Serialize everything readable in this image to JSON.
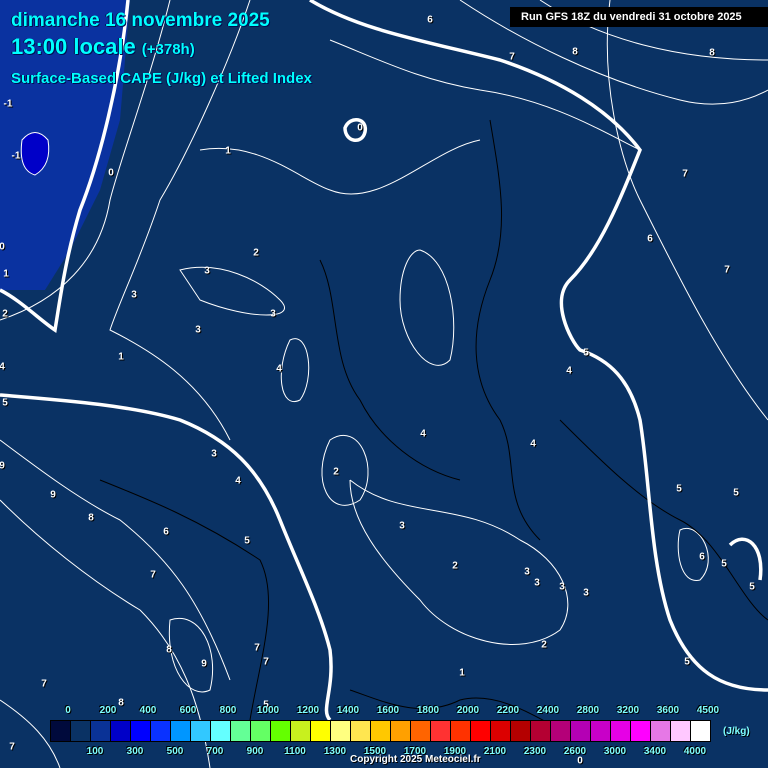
{
  "header": {
    "date": "dimanche 16 novembre 2025",
    "time": "13:00 locale",
    "lead": "(+378h)",
    "parameter": "Surface-Based CAPE (J/kg) et Lifted Index"
  },
  "run_info": "Run GFS 18Z du vendredi 31 octobre 2025",
  "map": {
    "contour_labels": [
      "6",
      "7",
      "8",
      "8",
      "-1",
      "0",
      "-1",
      "1",
      "0",
      "7",
      "6",
      "2",
      "0",
      "3",
      "7",
      "1",
      "3",
      "2",
      "3",
      "3",
      "1",
      "5",
      "4",
      "4",
      "4",
      "5",
      "4",
      "4",
      "3",
      "9",
      "2",
      "4",
      "9",
      "5",
      "5",
      "8",
      "6",
      "3",
      "5",
      "6",
      "5",
      "2",
      "3",
      "3",
      "7",
      "3",
      "3",
      "5",
      "2",
      "8",
      "7",
      "9",
      "7",
      "5",
      "1",
      "7",
      "8",
      "5",
      "7",
      "0"
    ]
  },
  "legend": {
    "colors": [
      "#000a3c",
      "#0a3264",
      "#0a3296",
      "#0000c8",
      "#0000ff",
      "#0a32ff",
      "#0096ff",
      "#32c8ff",
      "#64ffff",
      "#64ff96",
      "#64ff64",
      "#64ff00",
      "#c8f01e",
      "#ffff00",
      "#ffff80",
      "#ffe650",
      "#ffc800",
      "#ffa000",
      "#ff6400",
      "#ff3232",
      "#ff3200",
      "#ff0000",
      "#dc0000",
      "#b40000",
      "#b40032",
      "#b40078",
      "#b400b4",
      "#c800c8",
      "#e600e6",
      "#ff00ff",
      "#e678e6",
      "#ffc8ff",
      "#ffffff"
    ],
    "top_ticks": [
      "0",
      "200",
      "400",
      "600",
      "800",
      "1000",
      "1200",
      "1400",
      "1600",
      "1800",
      "2000",
      "2200",
      "2400",
      "2800",
      "3200",
      "3600",
      "4500"
    ],
    "bottom_ticks": [
      "100",
      "300",
      "500",
      "700",
      "900",
      "1100",
      "1300",
      "1500",
      "1700",
      "1900",
      "2100",
      "2300",
      "2600",
      "3000",
      "3400",
      "4000"
    ],
    "unit": "(J/kg)"
  },
  "copyright": "Copyright 2025 Meteociel.fr"
}
